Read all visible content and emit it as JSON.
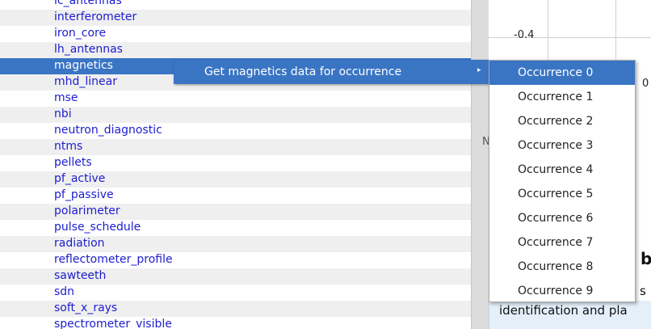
{
  "tree": {
    "items": [
      {
        "label": "ic_antennas",
        "style": ""
      },
      {
        "label": "interferometer",
        "style": "alt"
      },
      {
        "label": "iron_core",
        "style": ""
      },
      {
        "label": "lh_antennas",
        "style": "alt"
      },
      {
        "label": "magnetics",
        "style": "sel"
      },
      {
        "label": "mhd_linear",
        "style": "alt"
      },
      {
        "label": "mse",
        "style": ""
      },
      {
        "label": "nbi",
        "style": "alt"
      },
      {
        "label": "neutron_diagnostic",
        "style": ""
      },
      {
        "label": "ntms",
        "style": "alt"
      },
      {
        "label": "pellets",
        "style": ""
      },
      {
        "label": "pf_active",
        "style": "alt"
      },
      {
        "label": "pf_passive",
        "style": ""
      },
      {
        "label": "polarimeter",
        "style": "alt"
      },
      {
        "label": "pulse_schedule",
        "style": ""
      },
      {
        "label": "radiation",
        "style": "alt"
      },
      {
        "label": "reflectometer_profile",
        "style": ""
      },
      {
        "label": "sawteeth",
        "style": "alt"
      },
      {
        "label": "sdn",
        "style": ""
      },
      {
        "label": "soft_x_rays",
        "style": "alt"
      },
      {
        "label": "spectrometer_visible",
        "style": ""
      }
    ]
  },
  "context_menu": {
    "label": "Get magnetics data for occurrence",
    "arrow": "▸"
  },
  "submenu": {
    "items": [
      {
        "label": "Occurrence 0",
        "selected": true
      },
      {
        "label": "Occurrence 1",
        "selected": false
      },
      {
        "label": "Occurrence 2",
        "selected": false
      },
      {
        "label": "Occurrence 3",
        "selected": false
      },
      {
        "label": "Occurrence 4",
        "selected": false
      },
      {
        "label": "Occurrence 5",
        "selected": false
      },
      {
        "label": "Occurrence 6",
        "selected": false
      },
      {
        "label": "Occurrence 7",
        "selected": false
      },
      {
        "label": "Occurrence 8",
        "selected": false
      },
      {
        "label": "Occurrence 9",
        "selected": false
      }
    ]
  },
  "plot": {
    "y_tick": "-0.4",
    "x_tick": "0"
  },
  "background": {
    "stray_n": "N",
    "stray_b": "b",
    "stray_s": "s",
    "info_text": "identification and pla"
  },
  "colors": {
    "selection": "#3a75c4",
    "link_text": "#1d1dcf",
    "alt_row": "#efefef",
    "info_box": "#e4effa"
  }
}
